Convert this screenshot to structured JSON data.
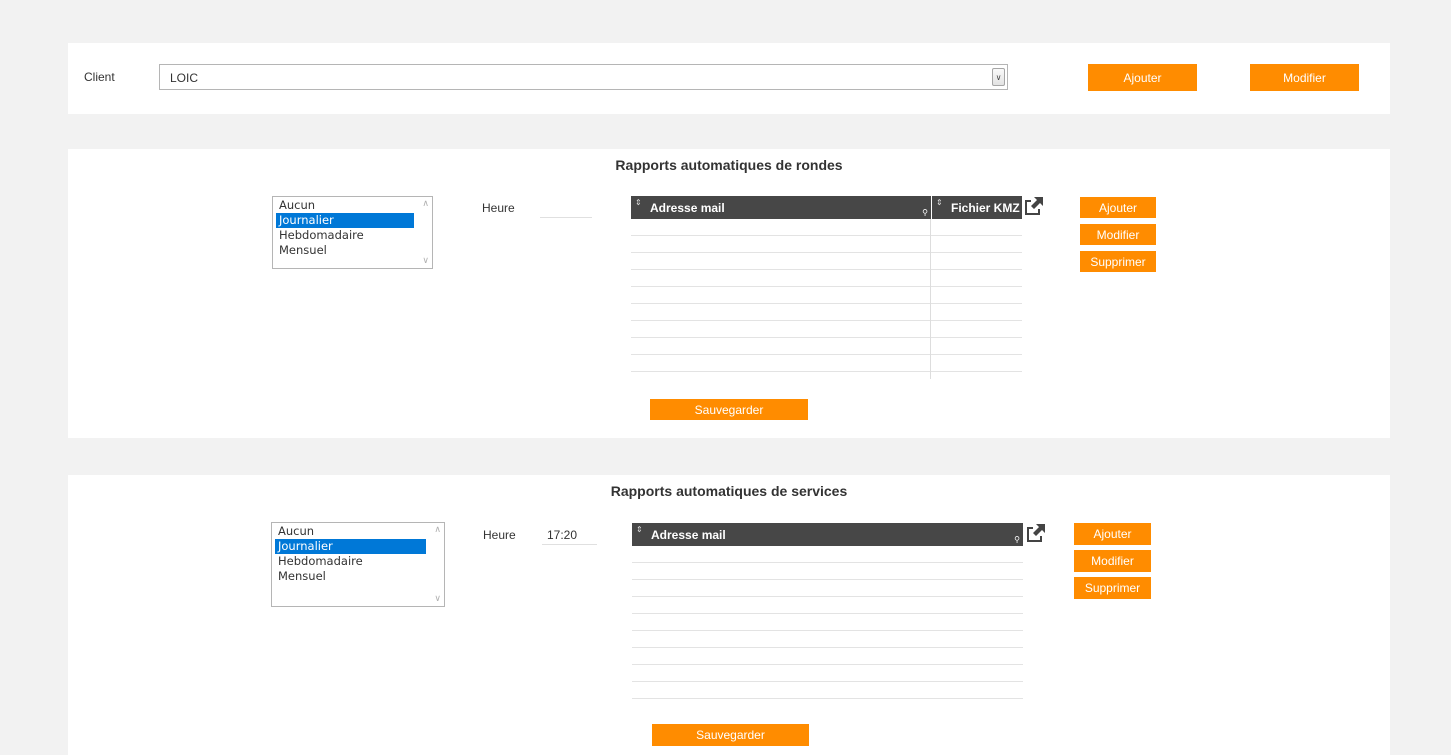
{
  "client_bar": {
    "label": "Client",
    "selected": "LOIC",
    "add_label": "Ajouter",
    "edit_label": "Modifier"
  },
  "rondes": {
    "title": "Rapports automatiques de rondes",
    "frequency_options": [
      "Aucun",
      "Journalier",
      "Hebdomadaire",
      "Mensuel"
    ],
    "frequency_selected": "Journalier",
    "hour_label": "Heure",
    "hour_value": "",
    "columns": [
      "Adresse mail",
      "Fichier KMZ"
    ],
    "rows": [],
    "add_label": "Ajouter",
    "edit_label": "Modifier",
    "delete_label": "Supprimer",
    "save_label": "Sauvegarder"
  },
  "services": {
    "title": "Rapports automatiques de services",
    "frequency_options": [
      "Aucun",
      "Journalier",
      "Hebdomadaire",
      "Mensuel"
    ],
    "frequency_selected": "Journalier",
    "hour_label": "Heure",
    "hour_value": "17:20",
    "columns": [
      "Adresse mail"
    ],
    "rows": [],
    "add_label": "Ajouter",
    "edit_label": "Modifier",
    "delete_label": "Supprimer",
    "save_label": "Sauvegarder"
  },
  "icons": {
    "export": "export-icon",
    "sort": "sort-icon",
    "search": "search-icon",
    "dropdown": "chevron-down-icon"
  },
  "colors": {
    "accent": "#ff8c00",
    "grid_header": "#474747",
    "selection": "#0078d7",
    "background": "#f2f2f2"
  }
}
